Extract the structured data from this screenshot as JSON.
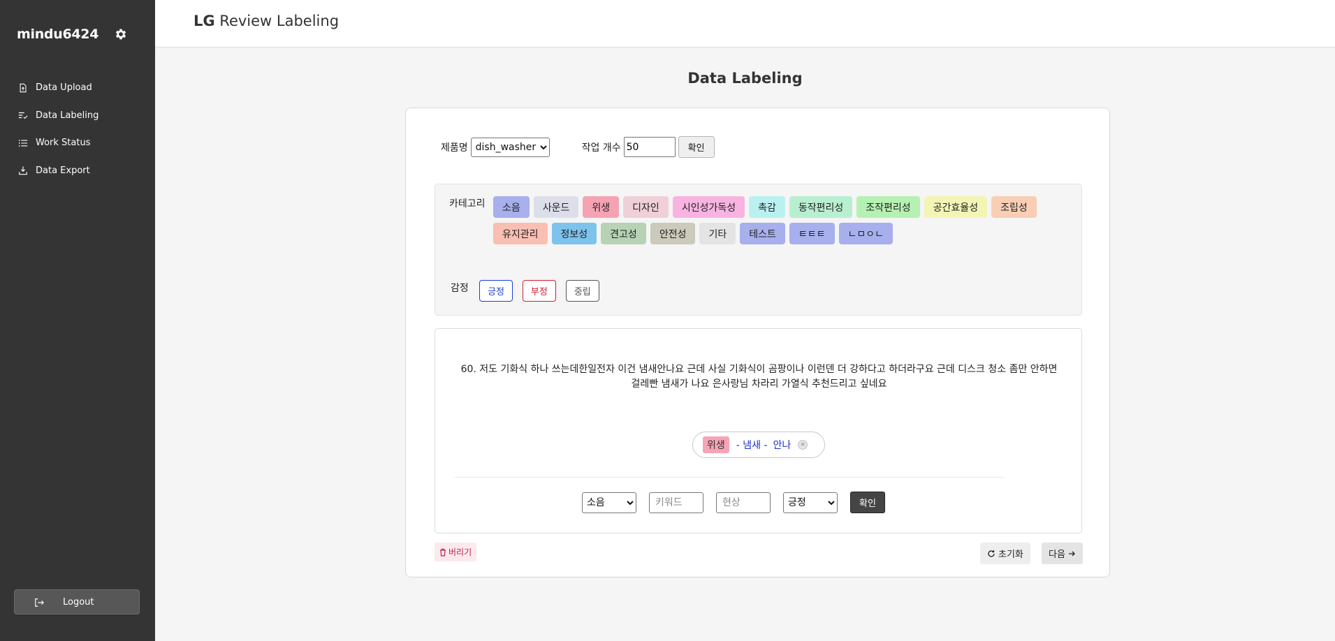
{
  "sidebar": {
    "username": "mindu6424",
    "items": [
      {
        "label": "Data Upload",
        "icon": "file-upload-icon"
      },
      {
        "label": "Data Labeling",
        "icon": "list-check-icon"
      },
      {
        "label": "Work Status",
        "icon": "list-icon"
      },
      {
        "label": "Data Export",
        "icon": "download-icon"
      }
    ],
    "logout_label": "Logout"
  },
  "header": {
    "brand_bold": "LG",
    "brand_rest": " Review Labeling"
  },
  "page_title": "Data Labeling",
  "controls": {
    "product_label": "제품명",
    "product_value": "dish_washer",
    "count_label": "작업 개수",
    "count_value": "50",
    "confirm_label": "확인"
  },
  "category": {
    "label": "카테고리",
    "chips": [
      {
        "label": "소음",
        "color": "#a7b0ec"
      },
      {
        "label": "사운드",
        "color": "#dcdfea"
      },
      {
        "label": "위생",
        "color": "#f5a3b3"
      },
      {
        "label": "디자인",
        "color": "#efd0d6"
      },
      {
        "label": "시인성가독성",
        "color": "#f8b3e1"
      },
      {
        "label": "촉감",
        "color": "#b9f1f0"
      },
      {
        "label": "동작편리성",
        "color": "#b9efd1"
      },
      {
        "label": "조작편리성",
        "color": "#b5f1b2"
      },
      {
        "label": "공간효율성",
        "color": "#f3f5b5"
      },
      {
        "label": "조립성",
        "color": "#f9ceb5"
      },
      {
        "label": "유지관리",
        "color": "#f9bfb2"
      },
      {
        "label": "정보성",
        "color": "#7dc3ec"
      },
      {
        "label": "견고성",
        "color": "#b7d2b5"
      },
      {
        "label": "안전성",
        "color": "#cbcabb"
      },
      {
        "label": "기타",
        "color": "#e4e4e4"
      },
      {
        "label": "테스트",
        "color": "#a7b0ec"
      },
      {
        "label": "ㅌㅌㅌ",
        "color": "#a7b0ec"
      },
      {
        "label": "ㄴㅁㅇㄴ",
        "color": "#a7b0ec"
      }
    ]
  },
  "sentiment": {
    "label": "감정",
    "options": [
      {
        "label": "긍정",
        "color": "#1a3fd6"
      },
      {
        "label": "부정",
        "color": "#d8192f"
      },
      {
        "label": "중립",
        "color": "#555555"
      }
    ]
  },
  "review": {
    "text": "60. 저도 기화식 하나 쓰는데한일전자 이건 냄새안나요 근데 사실 기화식이 곰팡이나 이런덴 더 강하다고 하더라구요 근데 디스크 청소 좀만 안하면 걸레빤 냄새가 나요 은사랑님 차라리 가열식 추천드리고 싶네요",
    "tag": {
      "category": "위생",
      "keyword": "- 냄새 -",
      "phenomenon": "안나",
      "remove": "×"
    }
  },
  "add_form": {
    "category_value": "소음",
    "keyword_placeholder": "키워드",
    "phenomenon_placeholder": "현상",
    "sentiment_value": "긍정",
    "confirm_label": "확인"
  },
  "footer": {
    "discard_label": "버리기",
    "reset_label": "초기화",
    "next_label": "다음"
  }
}
